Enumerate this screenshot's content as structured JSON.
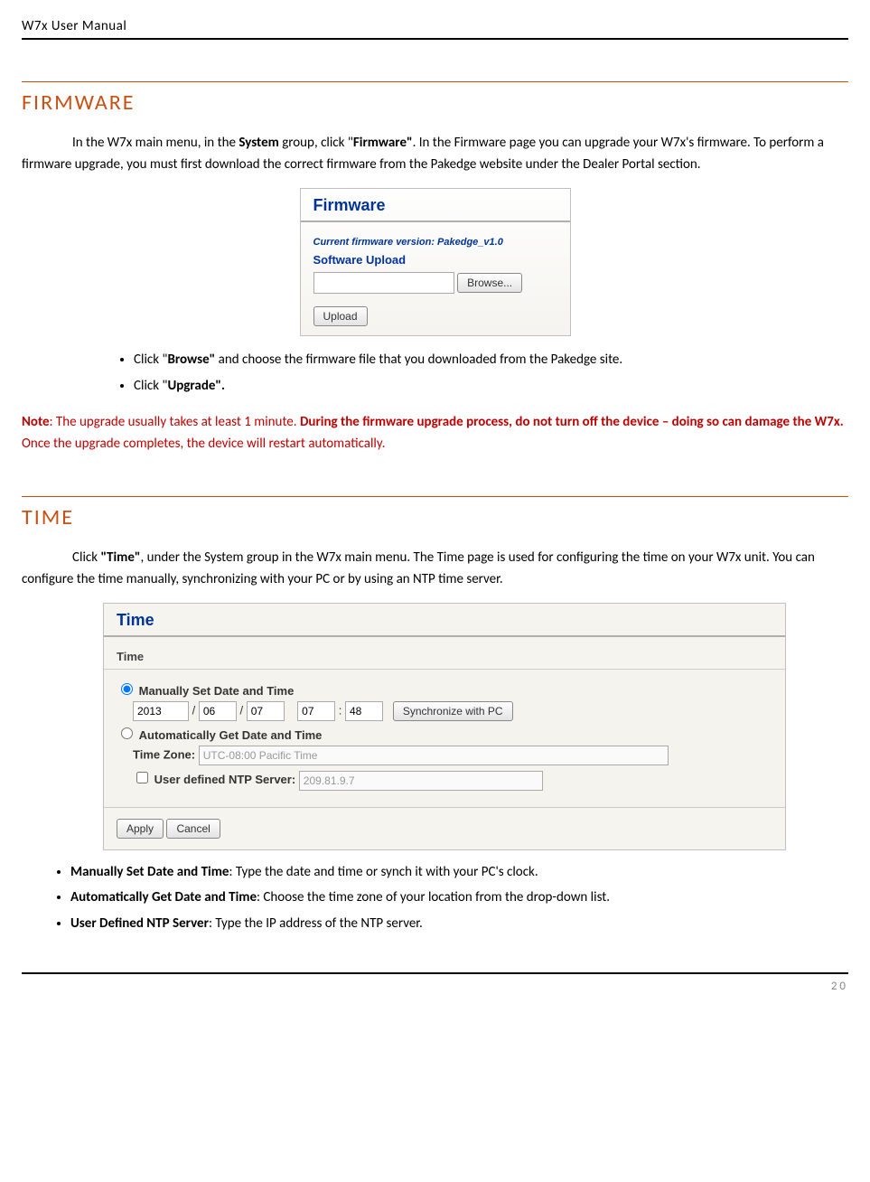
{
  "header": {
    "title": "W7x User Manual"
  },
  "footer": {
    "page": "20"
  },
  "firmware": {
    "heading": "FIRMWARE",
    "intro_1": "In the W7x main menu, in the ",
    "intro_bold1": "System",
    "intro_2": " group, click \"",
    "intro_bold2": "Firmware\"",
    "intro_3": ". In the Firmware page you can upgrade your W7x's firmware. To perform a firmware upgrade, you must first download the correct firmware from the Pakedge website under the Dealer Portal section.",
    "panel_title": "Firmware",
    "version_label": "Current firmware version: Pakedge_v1.0",
    "upload_label": "Software Upload",
    "browse_btn": "Browse...",
    "upload_btn": "Upload",
    "bullet1_a": "Click \"",
    "bullet1_b": "Browse\"",
    "bullet1_c": " and choose the firmware file that you downloaded from the Pakedge site.",
    "bullet2_a": "Click \"",
    "bullet2_b": "Upgrade\".",
    "note_a": "Note",
    "note_b": ": The upgrade usually takes at least 1 minute. ",
    "note_c": "During the firmware upgrade process, do not turn off the device – doing so can damage the W7x.",
    "note_d": " Once the upgrade completes, the device will restart automatically."
  },
  "time": {
    "heading": "TIME",
    "intro_a": "Click ",
    "intro_b": "\"Time\"",
    "intro_c": ", under the System group in the W7x main menu. The Time page is used for configuring the time on your W7x unit. You can configure the time manually, synchronizing with your PC or by using an NTP time server.",
    "panel_title": "Time",
    "legend": "Time",
    "manual_label": "Manually Set Date and Time",
    "year": "2013",
    "month": "06",
    "day": "07",
    "hour": "07",
    "minute": "48",
    "sync_btn": "Synchronize with PC",
    "auto_label": "Automatically Get Date and Time",
    "tz_label": "Time Zone:",
    "tz_value": "UTC-08:00 Pacific Time",
    "ntp_label": "User defined NTP Server:",
    "ntp_value": "209.81.9.7",
    "apply_btn": "Apply",
    "cancel_btn": "Cancel",
    "b1_a": "Manually Set Date and Time",
    "b1_b": ": Type the date and time or synch it with your PC's clock.",
    "b2_a": "Automatically Get Date and Time",
    "b2_b": ": Choose the time zone of your location from the drop-down list.",
    "b3_a": "User Defined NTP Server",
    "b3_b": ": Type the IP address of the NTP server."
  }
}
